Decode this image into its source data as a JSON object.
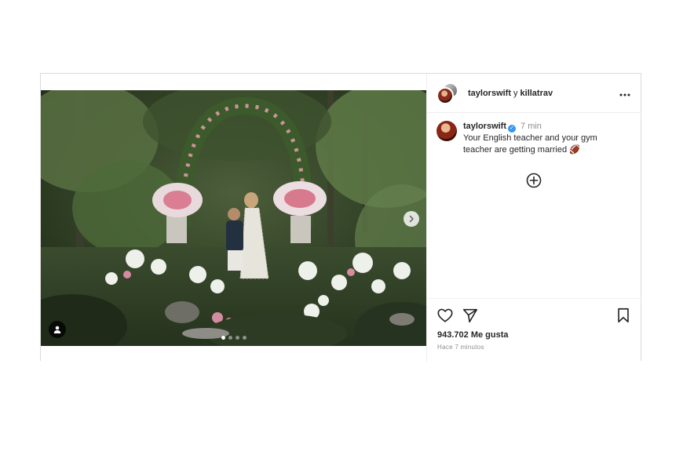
{
  "header": {
    "user1": "taylorswift",
    "separator": "y",
    "user2": "killatrav",
    "more_icon": "more-horizontal-icon"
  },
  "caption": {
    "username": "taylorswift",
    "verified_icon": "verified-badge-icon",
    "time": "7 min",
    "text": "Your English teacher and your gym teacher are getting married 🏈"
  },
  "media": {
    "next_icon": "chevron-right-icon",
    "tag_icon": "user-tag-icon",
    "carousel_position": 1,
    "carousel_count": 4
  },
  "actions": {
    "like_icon": "heart-icon",
    "share_icon": "send-icon",
    "save_icon": "bookmark-icon",
    "add_comment_icon": "plus-circle-icon"
  },
  "likes": "943.702 Me gusta",
  "posted_ago": "Hace 7 minutos"
}
